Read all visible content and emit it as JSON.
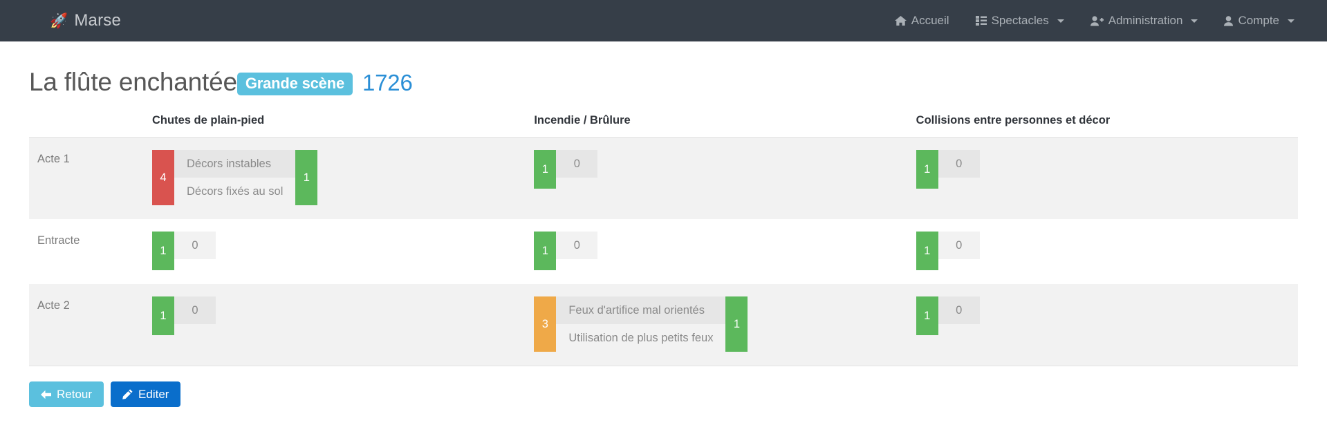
{
  "navbar": {
    "brand": {
      "icon": "rocket-icon",
      "glyph": "🚀",
      "label": "Marse"
    },
    "items": [
      {
        "icon": "home-icon",
        "label": "Accueil",
        "caret": false
      },
      {
        "icon": "list-icon",
        "label": "Spectacles",
        "caret": true
      },
      {
        "icon": "user-plus-icon",
        "label": "Administration",
        "caret": true
      },
      {
        "icon": "user-icon",
        "label": "Compte",
        "caret": true
      }
    ],
    "background": "#363e48",
    "text_color": "#aab0b6"
  },
  "page": {
    "title": "La flûte enchantée",
    "badge": "Grande scène",
    "badge_color": "#5bc0de",
    "id": "1726",
    "id_color": "#2b8fd6"
  },
  "table": {
    "act_column_header": "",
    "columns": [
      "Chutes de plain-pied",
      "Incendie / Brûlure",
      "Collisions entre personnes et décor"
    ],
    "rows": [
      {
        "act": "Acte 1",
        "cells": [
          {
            "type": "detailed",
            "severity": "4",
            "severity_color": "#d9534f",
            "measures": [
              "Décors instables",
              "Décors fixés au sol"
            ],
            "residual": "1",
            "residual_color": "#5cb85c"
          },
          {
            "type": "simple",
            "severity": "1",
            "severity_color": "#5cb85c",
            "residual": "0"
          },
          {
            "type": "simple",
            "severity": "1",
            "severity_color": "#5cb85c",
            "residual": "0"
          }
        ]
      },
      {
        "act": "Entracte",
        "cells": [
          {
            "type": "simple",
            "severity": "1",
            "severity_color": "#5cb85c",
            "residual": "0"
          },
          {
            "type": "simple",
            "severity": "1",
            "severity_color": "#5cb85c",
            "residual": "0"
          },
          {
            "type": "simple",
            "severity": "1",
            "severity_color": "#5cb85c",
            "residual": "0"
          }
        ]
      },
      {
        "act": "Acte 2",
        "cells": [
          {
            "type": "simple",
            "severity": "1",
            "severity_color": "#5cb85c",
            "residual": "0"
          },
          {
            "type": "detailed",
            "severity": "3",
            "severity_color": "#efa948",
            "measures": [
              "Feux d'artifice mal orientés",
              "Utilisation de plus petits feux"
            ],
            "residual": "1",
            "residual_color": "#5cb85c"
          },
          {
            "type": "simple",
            "severity": "1",
            "severity_color": "#5cb85c",
            "residual": "0"
          }
        ]
      }
    ]
  },
  "buttons": {
    "back": {
      "label": "Retour",
      "icon": "arrow-left-icon",
      "color": "#5bc0de"
    },
    "edit": {
      "label": "Editer",
      "icon": "pencil-icon",
      "color": "#0a6ecb"
    }
  }
}
